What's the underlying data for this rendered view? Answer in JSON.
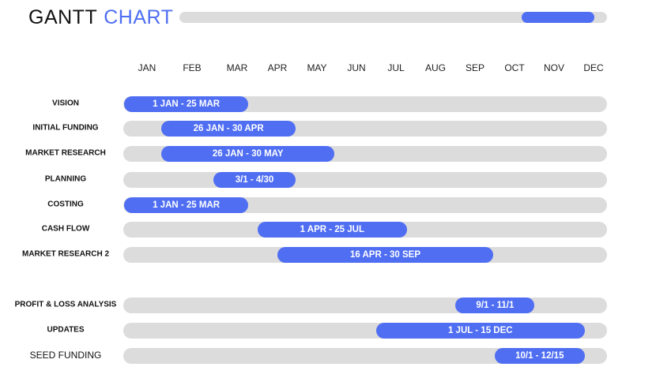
{
  "title": {
    "word1": "GANTT",
    "word2": "CHART"
  },
  "progress": {
    "start": 0.8,
    "end": 0.97
  },
  "chart_data": {
    "type": "gantt",
    "months": [
      "JAN",
      "FEB",
      "MAR",
      "APR",
      "MAY",
      "JUN",
      "JUL",
      "AUG",
      "SEP",
      "OCT",
      "NOV",
      "DEC"
    ],
    "tasks": [
      {
        "name": "VISION",
        "label": "1 JAN - 25 MAR",
        "start": "01-01",
        "end": "03-25"
      },
      {
        "name": "INITIAL FUNDING",
        "label": "26 JAN - 30 APR",
        "start": "01-26",
        "end": "04-30"
      },
      {
        "name": "MARKET RESEARCH",
        "label": "26 JAN - 30 MAY",
        "start": "01-26",
        "end": "05-30"
      },
      {
        "name": "PLANNING",
        "label": "3/1 - 4/30",
        "start": "03-01",
        "end": "04-30"
      },
      {
        "name": "COSTING",
        "label": "1 JAN - 25 MAR",
        "start": "01-01",
        "end": "03-25"
      },
      {
        "name": "CASH FLOW",
        "label": "1 APR - 25 JUL",
        "start": "04-01",
        "end": "07-25"
      },
      {
        "name": "MARKET RESEARCH 2",
        "label": "16 APR - 30 SEP",
        "start": "04-16",
        "end": "09-30"
      },
      {
        "name": "PROFIT & LOSS ANALYSIS",
        "label": "9/1 - 11/1",
        "start": "09-01",
        "end": "11-01"
      },
      {
        "name": "UPDATES",
        "label": "1 JUL - 15 DEC",
        "start": "07-01",
        "end": "12-15"
      },
      {
        "name": "SEED FUNDING",
        "label": "10/1 - 12/15",
        "start": "10-01",
        "end": "12-15"
      }
    ],
    "colors": {
      "bar": "#4f6ef2",
      "track": "#dcdcdc"
    }
  }
}
